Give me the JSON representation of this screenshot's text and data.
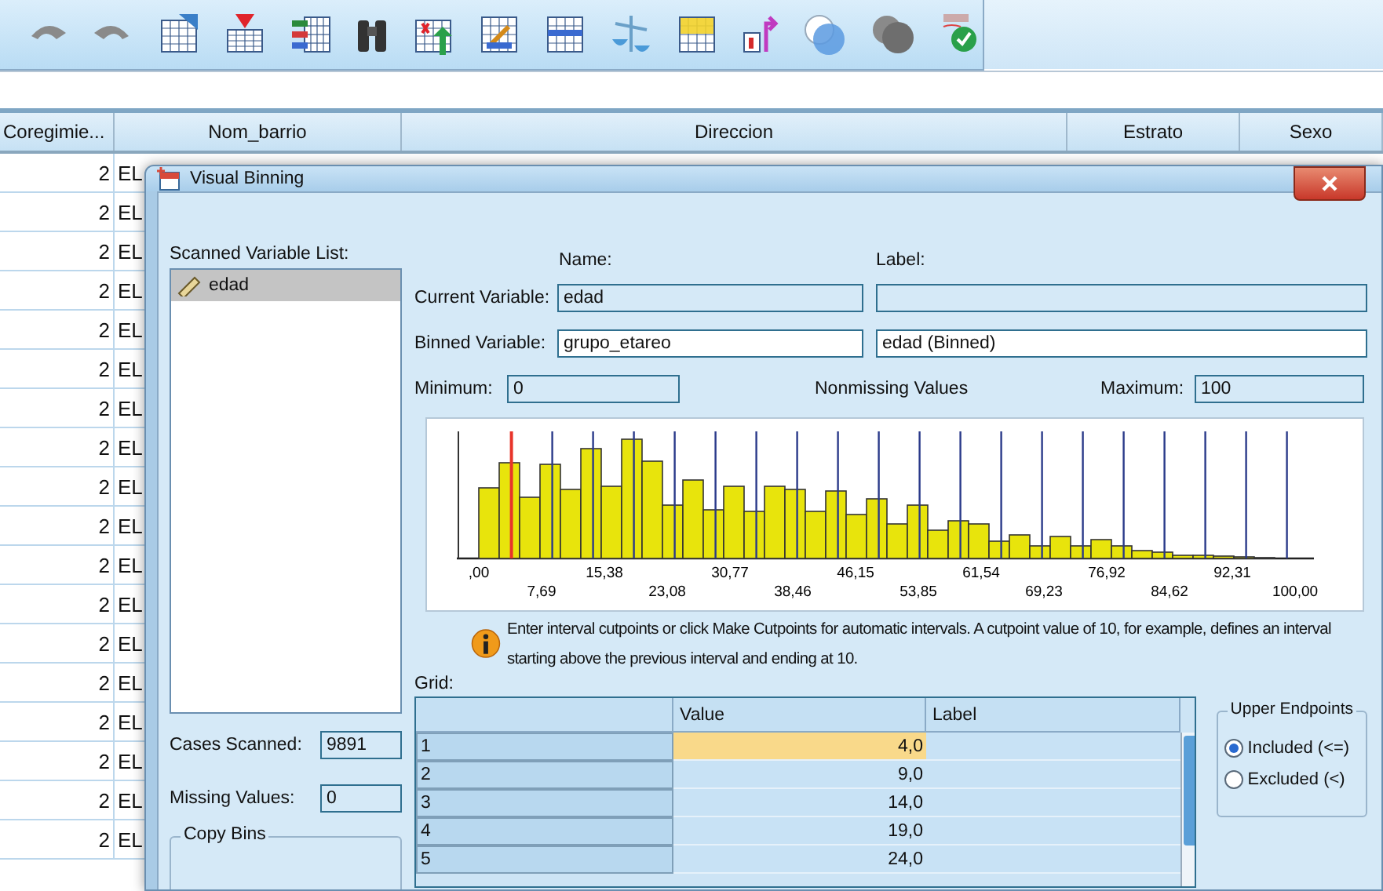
{
  "data_grid": {
    "columns": [
      "Coregimie...",
      "Nom_barrio",
      "Direccion",
      "Estrato",
      "Sexo"
    ],
    "rows": [
      {
        "coregimiento": "2",
        "nom_barrio": "EL"
      },
      {
        "coregimiento": "2",
        "nom_barrio": "EL"
      },
      {
        "coregimiento": "2",
        "nom_barrio": "EL"
      },
      {
        "coregimiento": "2",
        "nom_barrio": "EL"
      },
      {
        "coregimiento": "2",
        "nom_barrio": "EL"
      },
      {
        "coregimiento": "2",
        "nom_barrio": "EL"
      },
      {
        "coregimiento": "2",
        "nom_barrio": "EL"
      },
      {
        "coregimiento": "2",
        "nom_barrio": "EL"
      },
      {
        "coregimiento": "2",
        "nom_barrio": "EL"
      },
      {
        "coregimiento": "2",
        "nom_barrio": "EL"
      },
      {
        "coregimiento": "2",
        "nom_barrio": "EL"
      },
      {
        "coregimiento": "2",
        "nom_barrio": "EL"
      },
      {
        "coregimiento": "2",
        "nom_barrio": "EL"
      },
      {
        "coregimiento": "2",
        "nom_barrio": "EL"
      },
      {
        "coregimiento": "2",
        "nom_barrio": "EL"
      },
      {
        "coregimiento": "2",
        "nom_barrio": "EL"
      },
      {
        "coregimiento": "2",
        "nom_barrio": "EL"
      },
      {
        "coregimiento": "2",
        "nom_barrio": "EL"
      }
    ]
  },
  "dialog": {
    "title": "Visual Binning",
    "scanned_label": "Scanned Variable List:",
    "variables": [
      {
        "name": "edad",
        "selected": true
      }
    ],
    "name_header": "Name:",
    "label_header": "Label:",
    "current_variable": {
      "label": "Current Variable:",
      "name": "edad"
    },
    "binned_variable": {
      "label": "Binned Variable:",
      "name": "grupo_etareo",
      "label_value": "edad (Binned)"
    },
    "minimum": {
      "label": "Minimum:",
      "value": "0"
    },
    "nonmissing": "Nonmissing Values",
    "maximum": {
      "label": "Maximum:",
      "value": "100"
    },
    "histogram": {
      "tick_labels": [
        ",00",
        "7,69",
        "15,38",
        "23,08",
        "30,77",
        "38,46",
        "46,15",
        "53,85",
        "61,54",
        "69,23",
        "76,92",
        "84,62",
        "92,31",
        "100,00"
      ]
    },
    "info": "Enter interval cutpoints or click Make Cutpoints for automatic intervals. A cutpoint value of 10, for example, defines an interval starting above the previous interval and ending at 10.",
    "grid": {
      "label": "Grid:",
      "columns": [
        "Value",
        "Label"
      ],
      "rows": [
        {
          "index": "1",
          "value": "4,0",
          "selected": true
        },
        {
          "index": "2",
          "value": "9,0",
          "selected": false
        },
        {
          "index": "3",
          "value": "14,0",
          "selected": false
        },
        {
          "index": "4",
          "value": "19,0",
          "selected": false
        },
        {
          "index": "5",
          "value": "24,0",
          "selected": false
        }
      ]
    },
    "cases_scanned": {
      "label": "Cases Scanned:",
      "value": "9891"
    },
    "missing_values": {
      "label": "Missing Values:",
      "value": "0"
    },
    "copy_bins": {
      "title": "Copy Bins"
    },
    "upper_endpoints": {
      "title": "Upper Endpoints",
      "options": [
        {
          "label": "Included (<=)",
          "selected": true
        },
        {
          "label": "Excluded (<)",
          "selected": false
        }
      ]
    }
  }
}
